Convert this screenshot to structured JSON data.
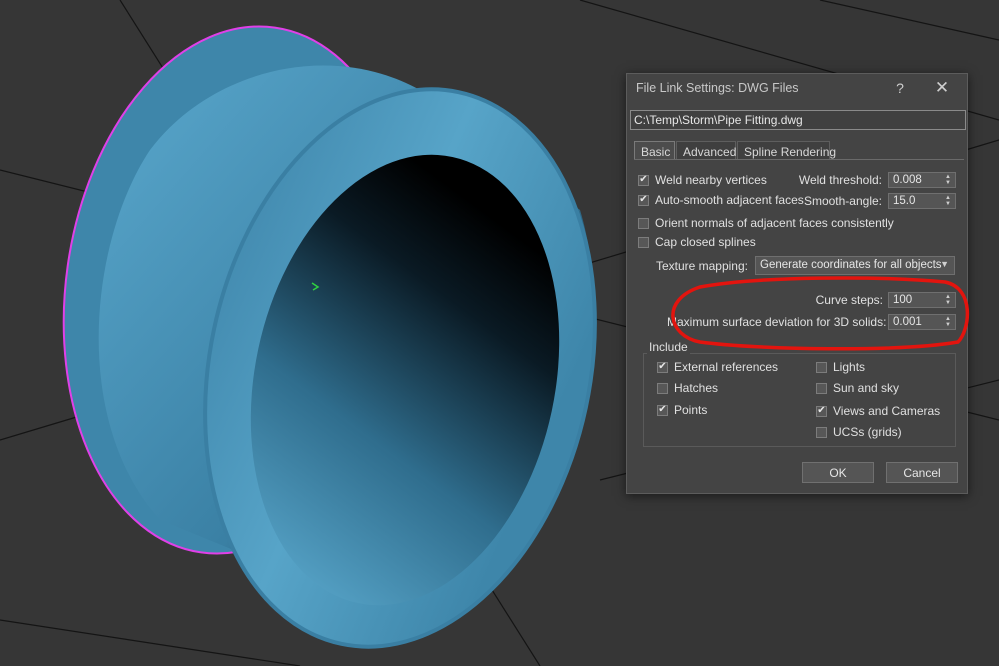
{
  "dialog": {
    "title": "File Link Settings: DWG Files",
    "help_glyph": "?",
    "close_glyph": "✕",
    "file_path": "C:\\Temp\\Storm\\Pipe Fitting.dwg",
    "tabs": [
      {
        "label": "Basic",
        "active": true
      },
      {
        "label": "Advanced",
        "active": false
      },
      {
        "label": "Spline Rendering",
        "active": false
      }
    ],
    "basic": {
      "weld_nearby_vertices": {
        "label": "Weld nearby vertices",
        "checked": true
      },
      "weld_threshold": {
        "label": "Weld threshold:",
        "value": "0.008"
      },
      "auto_smooth": {
        "label": "Auto-smooth adjacent faces",
        "checked": true
      },
      "smooth_angle": {
        "label": "Smooth-angle:",
        "value": "15.0"
      },
      "orient_normals": {
        "label": "Orient normals of adjacent faces consistently",
        "checked": false
      },
      "cap_closed_splines": {
        "label": "Cap closed splines",
        "checked": false
      },
      "texture_mapping": {
        "label": "Texture mapping:",
        "value": "Generate coordinates for all objects"
      },
      "curve_steps": {
        "label": "Curve steps:",
        "value": "100"
      },
      "max_surface_deviation": {
        "label": "Maximum surface deviation for 3D solids:",
        "value": "0.001"
      }
    },
    "include": {
      "title": "Include",
      "external_references": {
        "label": "External references",
        "checked": true
      },
      "hatches": {
        "label": "Hatches",
        "checked": false
      },
      "points": {
        "label": "Points",
        "checked": true
      },
      "lights": {
        "label": "Lights",
        "checked": false
      },
      "sun_and_sky": {
        "label": "Sun and sky",
        "checked": false
      },
      "views_and_cameras": {
        "label": "Views and Cameras",
        "checked": true
      },
      "ucss": {
        "label": "UCSs (grids)",
        "checked": false
      }
    },
    "ok_label": "OK",
    "cancel_label": "Cancel"
  },
  "colors": {
    "viewport_bg": "#363636",
    "grid_line": "#141414",
    "model_blue": "#4f9bbf",
    "selection_edge": "#e040e8",
    "dialog_bg": "#444444",
    "annotation": "#e3140e"
  }
}
